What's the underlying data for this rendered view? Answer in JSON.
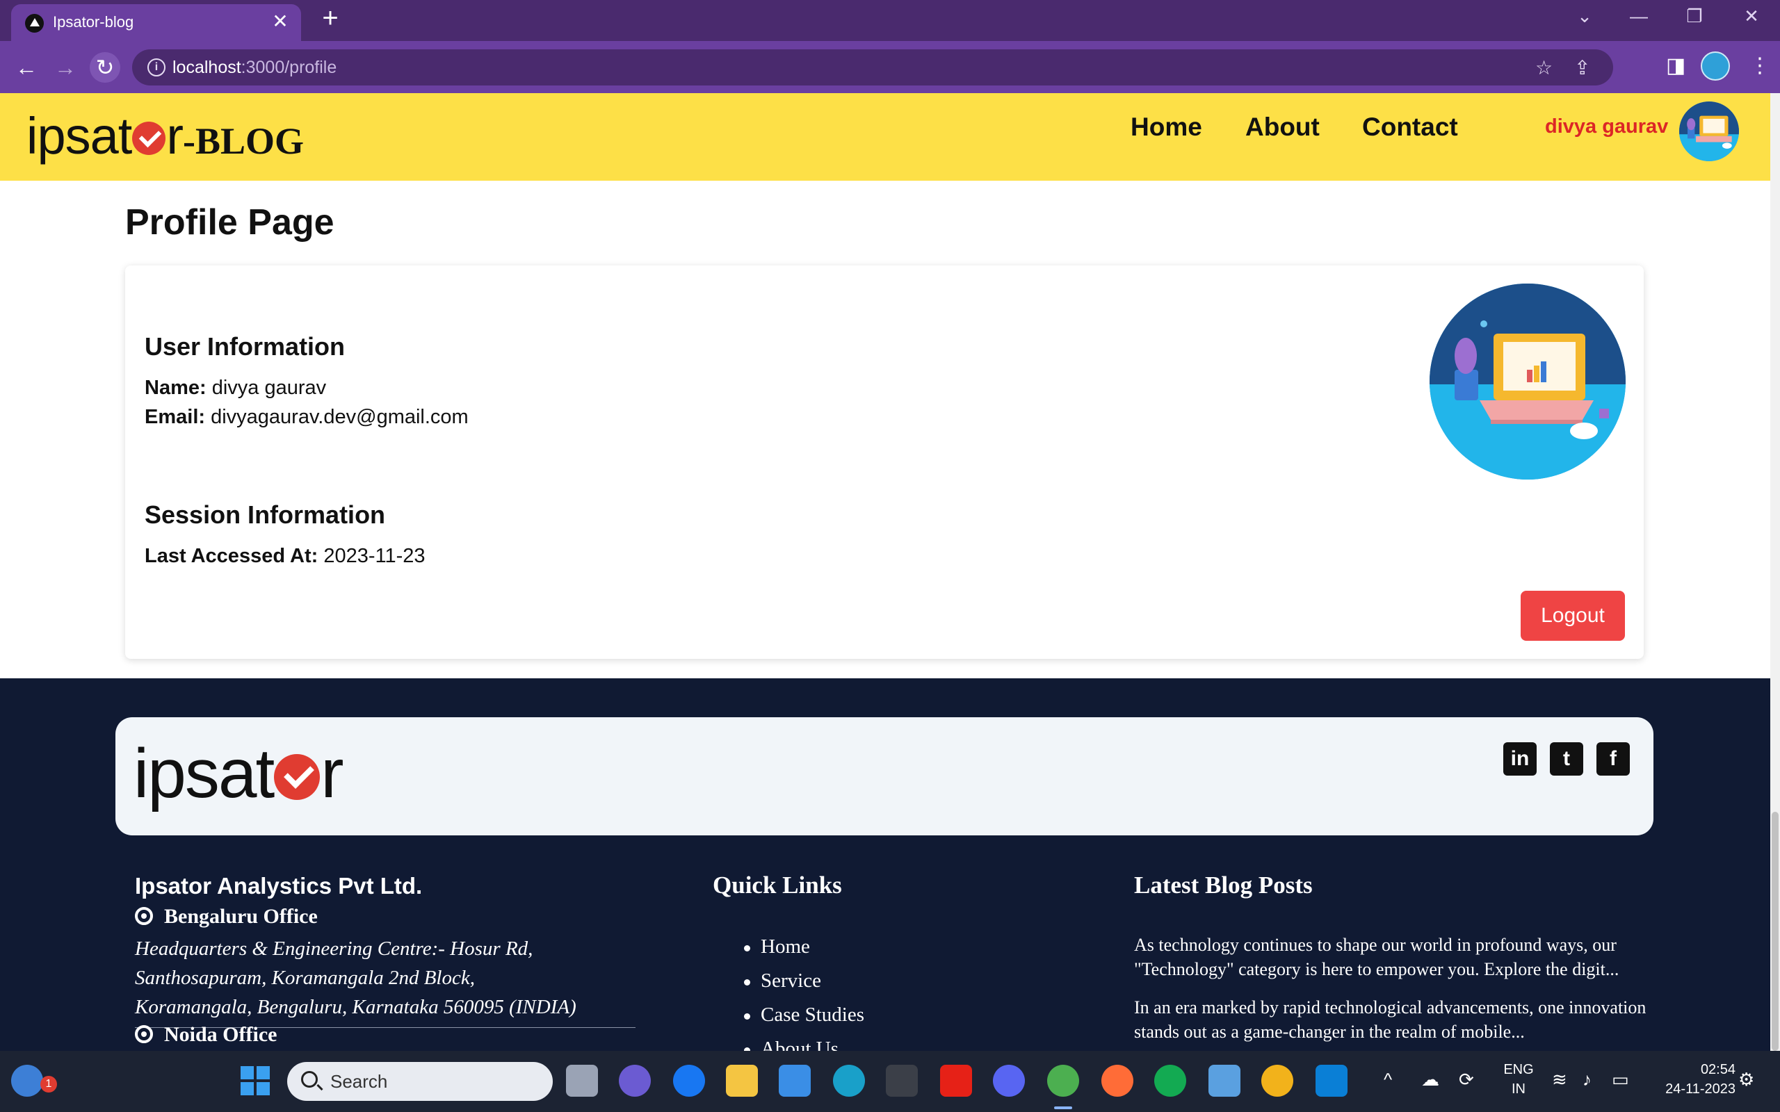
{
  "browser": {
    "tab_title": "Ipsator-blog",
    "url_host": "localhost",
    "url_path": ":3000/profile"
  },
  "header": {
    "logo_text": "ipsat",
    "logo_tail": "r",
    "logo_suffix": "-BLOG",
    "nav": [
      "Home",
      "About",
      "Contact"
    ],
    "user_name": "divya gaurav"
  },
  "profile": {
    "page_title": "Profile Page",
    "user_info_heading": "User Information",
    "name_label": "Name:",
    "name_value": "divya gaurav",
    "email_label": "Email:",
    "email_value": "divyagaurav.dev@gmail.com",
    "session_heading": "Session Information",
    "last_accessed_label": "Last Accessed At:",
    "last_accessed_value": "2023-11-23",
    "logout_label": "Logout"
  },
  "footer": {
    "logo_text": "ipsat",
    "logo_tail": "r",
    "social": [
      "in",
      "t",
      "f"
    ],
    "company": "Ipsator Analystics Pvt Ltd.",
    "office1": "Bengaluru Office",
    "address1_line1": "Headquarters & Engineering Centre:- Hosur Rd,",
    "address1_line2": "Santhosapuram, Koramangala 2nd Block,",
    "address1_line3": "Koramangala, Bengaluru, Karnataka 560095 (INDIA)",
    "office2": "Noida Office",
    "quick_links_heading": "Quick Links",
    "quick_links": [
      "Home",
      "Service",
      "Case Studies",
      "About Us"
    ],
    "latest_posts_heading": "Latest Blog Posts",
    "post1": "As technology continues to shape our world in profound ways, our \"Technology\" category is here to empower you. Explore the digit...",
    "post2": "In an era marked by rapid technological advancements, one innovation stands out as a game-changer in the realm of mobile..."
  },
  "taskbar": {
    "weather_badge": "1",
    "search_label": "Search",
    "lang_top": "ENG",
    "lang_bottom": "IN",
    "time": "02:54",
    "date": "24-11-2023"
  },
  "colors": {
    "header_bg": "#fde047",
    "accent_red": "#dc2626",
    "logout_bg": "#ef4444",
    "footer_bg": "#101a33",
    "browser_purple": "#6a3fa0"
  }
}
